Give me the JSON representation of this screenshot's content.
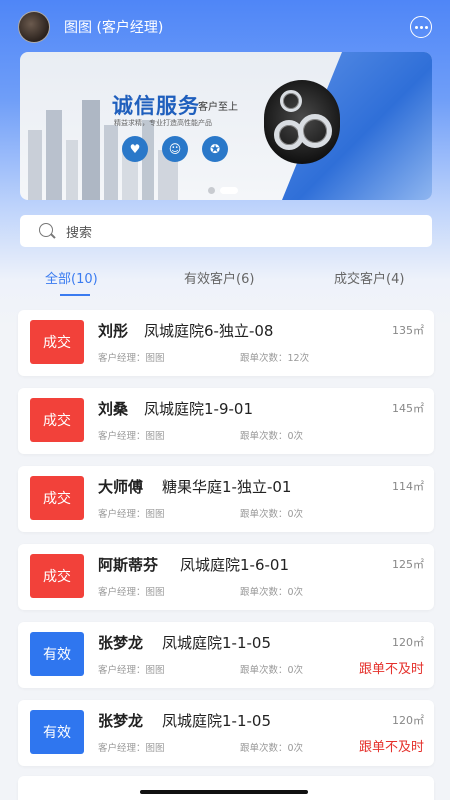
{
  "header": {
    "title": "图图 (客户经理)",
    "more_icon": "more-dots-icon"
  },
  "banner": {
    "title": "诚信服务",
    "tag": "客户至上",
    "subtitle": "精益求精，专业打造高性能产品"
  },
  "search": {
    "placeholder": "搜索",
    "icon": "search-icon"
  },
  "tabs": [
    {
      "label": "全部(10)",
      "active": true
    },
    {
      "label": "有效客户(6)",
      "active": false
    },
    {
      "label": "成交客户(4)",
      "active": false
    }
  ],
  "customers": [
    {
      "status": "成交",
      "name": "刘彤",
      "address": "凤城庭院6-独立-08",
      "area": "135㎡",
      "manager": "客户经理：图图",
      "follow": "跟单次数：12次",
      "warning": ""
    },
    {
      "status": "成交",
      "name": "刘桑",
      "address": "凤城庭院1-9-01",
      "area": "145㎡",
      "manager": "客户经理：图图",
      "follow": "跟单次数：0次",
      "warning": ""
    },
    {
      "status": "成交",
      "name": "大师傅",
      "address": "糖果华庭1-独立-01",
      "area": "114㎡",
      "manager": "客户经理：图图",
      "follow": "跟单次数：0次",
      "warning": ""
    },
    {
      "status": "成交",
      "name": "阿斯蒂芬",
      "address": "凤城庭院1-6-01",
      "area": "125㎡",
      "manager": "客户经理：图图",
      "follow": "跟单次数：0次",
      "warning": ""
    },
    {
      "status": "有效",
      "name": "张梦龙",
      "address": "凤城庭院1-1-05",
      "area": "120㎡",
      "manager": "客户经理：图图",
      "follow": "跟单次数：0次",
      "warning": "跟单不及时"
    },
    {
      "status": "有效",
      "name": "张梦龙",
      "address": "凤城庭院1-1-05",
      "area": "120㎡",
      "manager": "客户经理：图图",
      "follow": "跟单次数：0次",
      "warning": "跟单不及时"
    }
  ],
  "colors": {
    "primary": "#3a7bf0",
    "deal_badge": "#f2413a",
    "valid_badge": "#2f76ef",
    "warning": "#e5312c"
  }
}
